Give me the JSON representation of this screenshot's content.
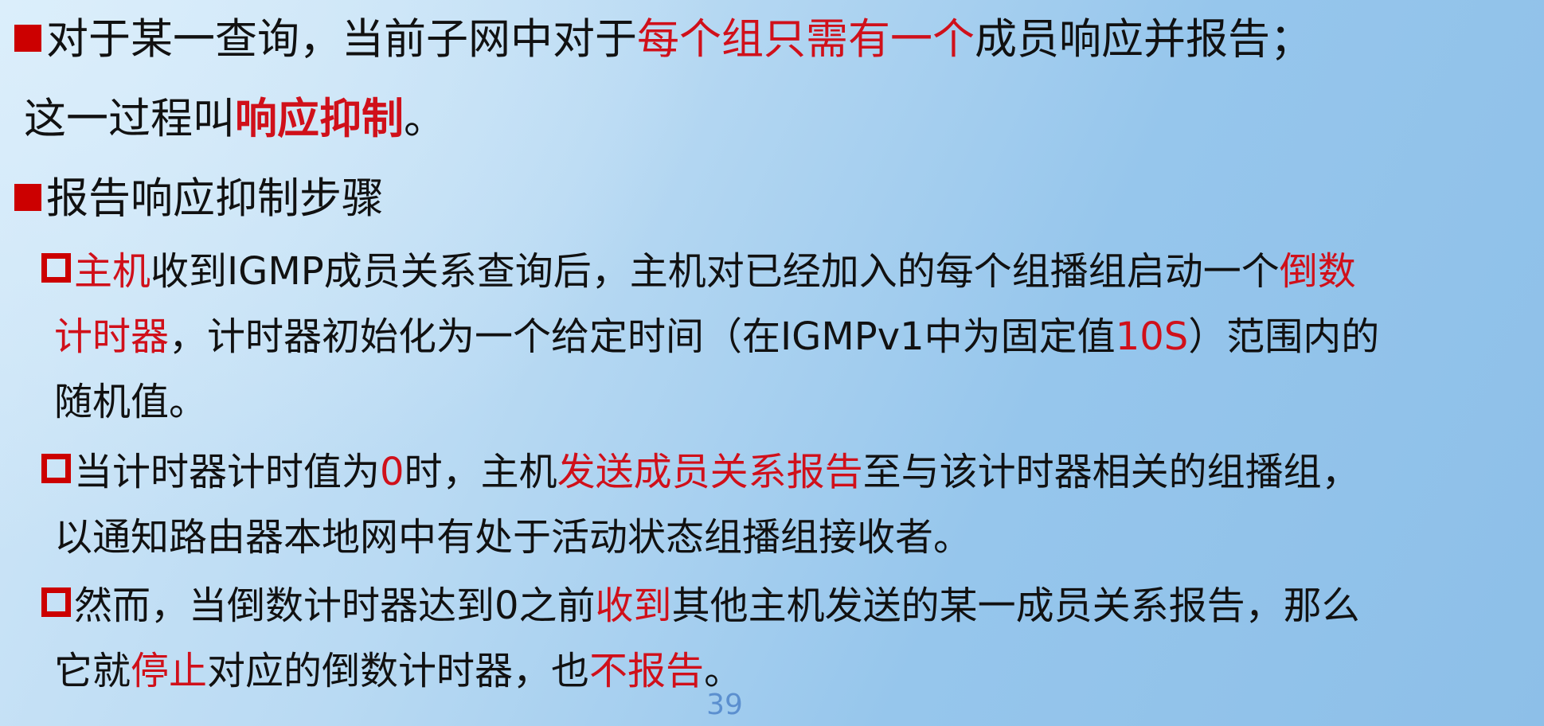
{
  "slide": {
    "p1": {
      "line1_a": "对于某一查询，当前子网中对于",
      "line1_red": "每个组只需有一个",
      "line1_b": "成员响应并报告；",
      "line2_a": "这一过程叫",
      "line2_bold": "响应抑制",
      "line2_b": "。"
    },
    "p2": {
      "heading": "报告响应抑制步骤"
    },
    "s1": {
      "red1": "主机",
      "t1": "收到IGMP成员关系查询后，主机对已经加入的每个组播组启动一个",
      "red2": "倒数",
      "red3": "计时器",
      "t2": "，计时器初始化为一个给定时间（在IGMPv1中为固定值",
      "red4": "10S",
      "t3": "）范围内的",
      "t4": "随机值。"
    },
    "s2": {
      "t1": "当计时器计时值为",
      "red1": "0",
      "t2": "时，主机",
      "red2": "发送成员关系报告",
      "t3": "至与该计时器相关的组播组，",
      "t4": "以通知路由器本地网中有处于活动状态组播组接收者。"
    },
    "s3": {
      "t1": "然而，当倒数计时器达到0之前",
      "red1": "收到",
      "t2": "其他主机发送的某一成员关系报告，那么",
      "t3": "它就",
      "red2": "停止",
      "t4": "对应的倒数计时器，也",
      "red3": "不报告",
      "t5": "。"
    },
    "page_number": "39",
    "colors": {
      "accent_red": "#d0101a",
      "bullet_red": "#cc0000",
      "page_number_blue": "#5b8fcf"
    },
    "icons": {
      "level1_bullet": "filled-square-bullet-icon",
      "level2_bullet": "hollow-square-bullet-icon"
    }
  }
}
